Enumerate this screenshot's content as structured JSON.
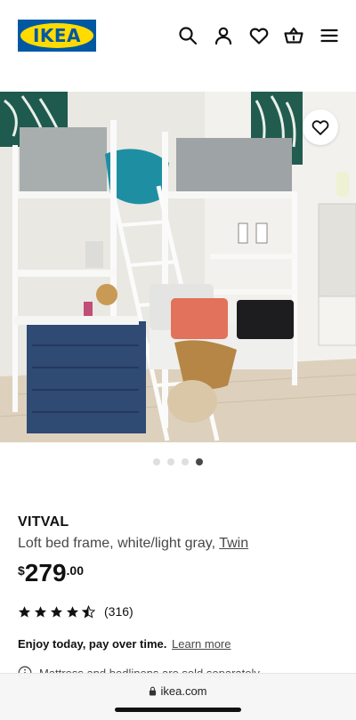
{
  "header": {
    "logo_text": "IKEA",
    "icons": [
      "search-icon",
      "account-icon",
      "heart-icon",
      "cart-icon",
      "menu-icon"
    ],
    "brand_colors": {
      "blue": "#0058a3",
      "yellow": "#ffdb00"
    }
  },
  "gallery": {
    "image_description": "VITVAL loft bed frame room scene",
    "slide_count": 4,
    "active_slide": 4,
    "favorite_icon": "heart-icon"
  },
  "product": {
    "name": "VITVAL",
    "description": "Loft bed frame, white/light gray, ",
    "size": "Twin",
    "price_currency": "$",
    "price_whole": "279",
    "price_decimal": ".00",
    "rating_value": 4.5,
    "rating_max": 5,
    "review_count": "(316)",
    "finance_text": "Enjoy today, pay over time.",
    "finance_link": "Learn more",
    "notice_text": "Mattress and bedlinens are sold separately"
  },
  "browser": {
    "url": "ikea.com",
    "lock_icon": "lock-icon"
  }
}
